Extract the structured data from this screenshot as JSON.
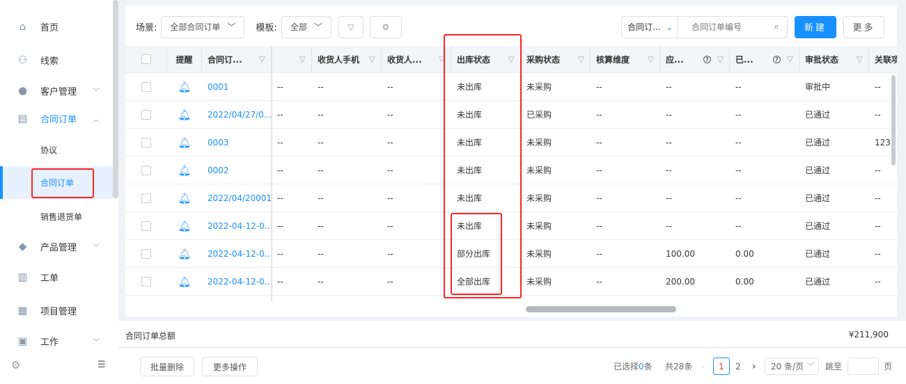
{
  "sidebar": {
    "items": [
      {
        "label": "首页",
        "icon": "home-icon"
      },
      {
        "label": "线索",
        "icon": "leads-icon"
      },
      {
        "label": "客户管理",
        "icon": "customer-icon",
        "chevron": "down"
      },
      {
        "label": "合同订单",
        "icon": "contract-icon",
        "chevron": "up"
      },
      {
        "label": "协议"
      },
      {
        "label": "合同订单"
      },
      {
        "label": "销售退货单"
      },
      {
        "label": "产品管理",
        "icon": "product-icon",
        "chevron": "down"
      },
      {
        "label": "工单",
        "icon": "clipboard-icon"
      },
      {
        "label": "项目管理",
        "icon": "folder-icon"
      },
      {
        "label": "工作",
        "icon": "card-icon",
        "chevron": "down"
      }
    ]
  },
  "toolbar": {
    "scene_label": "场景:",
    "scene_value": "全部合同订单",
    "template_label": "模板:",
    "template_value": "全部",
    "search_field": "合同订...",
    "search_placeholder": "合同订单编号",
    "new_label": "新建",
    "more_label": "更多"
  },
  "table": {
    "headers": [
      "提醒",
      "合同订...",
      "",
      "收货人手机",
      "收货人...",
      "出库状态",
      "采购状态",
      "核算维度",
      "应...",
      "已...",
      "审批状态",
      "关联项"
    ],
    "rows": [
      [
        "0001",
        "--",
        "--",
        "--",
        "未出库",
        "未采购",
        "--",
        "--",
        "--",
        "审批中",
        "--"
      ],
      [
        "2022/04/27/0...",
        "--",
        "--",
        "--",
        "未出库",
        "已采购",
        "--",
        "--",
        "--",
        "已通过",
        "--"
      ],
      [
        "0003",
        "--",
        "--",
        "--",
        "未出库",
        "未采购",
        "--",
        "--",
        "--",
        "已通过",
        "123"
      ],
      [
        "0002",
        "--",
        "--",
        "--",
        "未出库",
        "未采购",
        "--",
        "--",
        "--",
        "已通过",
        "--"
      ],
      [
        "2022/04/20001",
        "--",
        "--",
        "--",
        "未出库",
        "未采购",
        "--",
        "--",
        "--",
        "已通过",
        "--"
      ],
      [
        "2022-04-12-0...",
        "--",
        "--",
        "--",
        "未出库",
        "未采购",
        "--",
        "--",
        "--",
        "已通过",
        "--"
      ],
      [
        "2022-04-12-0...",
        "--",
        "--",
        "--",
        "部分出库",
        "未采购",
        "--",
        "100.00",
        "0.00",
        "已通过",
        "--"
      ],
      [
        "2022-04-12-0...",
        "--",
        "--",
        "--",
        "全部出库",
        "未采购",
        "--",
        "200.00",
        "0.00",
        "已通过",
        "--"
      ]
    ]
  },
  "summary": {
    "label": "合同订单总额",
    "value": "¥211,900"
  },
  "footer": {
    "batch_delete": "批量删除",
    "more_ops": "更多操作",
    "selected_prefix": "已选择",
    "selected_count": "0",
    "selected_suffix": "条",
    "total": "共28条",
    "pages": [
      "1",
      "2"
    ],
    "current_page": "1",
    "page_size": "20 条/页",
    "jump_label": "跳至",
    "page_unit": "页"
  },
  "colors": {
    "accent": "#1890ff",
    "highlight_box": "#ff2222"
  }
}
